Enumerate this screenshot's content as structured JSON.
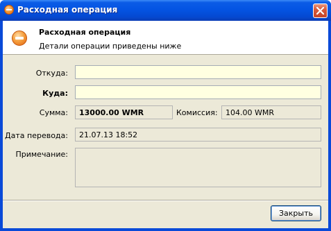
{
  "window": {
    "title": "Расходная операция",
    "title_icon": "minus-circle-icon",
    "close_icon": "close-x-icon"
  },
  "header": {
    "title": "Расходная операция",
    "subtitle": "Детали операции приведены ниже",
    "icon": "minus-circle-icon"
  },
  "form": {
    "from_label": "Откуда:",
    "from_value": "",
    "to_label": "Куда:",
    "to_value": "",
    "amount_label": "Сумма:",
    "amount_value": "13000.00 WMR",
    "commission_label": "Комиссия:",
    "commission_value": "104.00 WMR",
    "date_label": "Дата перевода:",
    "date_value": "21.07.13 18:52",
    "note_label": "Примечание:",
    "note_value": ""
  },
  "buttons": {
    "close_label": "Закрыть"
  },
  "colors": {
    "titlebar": "#0454e3",
    "dialog_bg": "#ece9d8",
    "input_bg": "#ffffe1",
    "icon_orange": "#f39a35"
  }
}
